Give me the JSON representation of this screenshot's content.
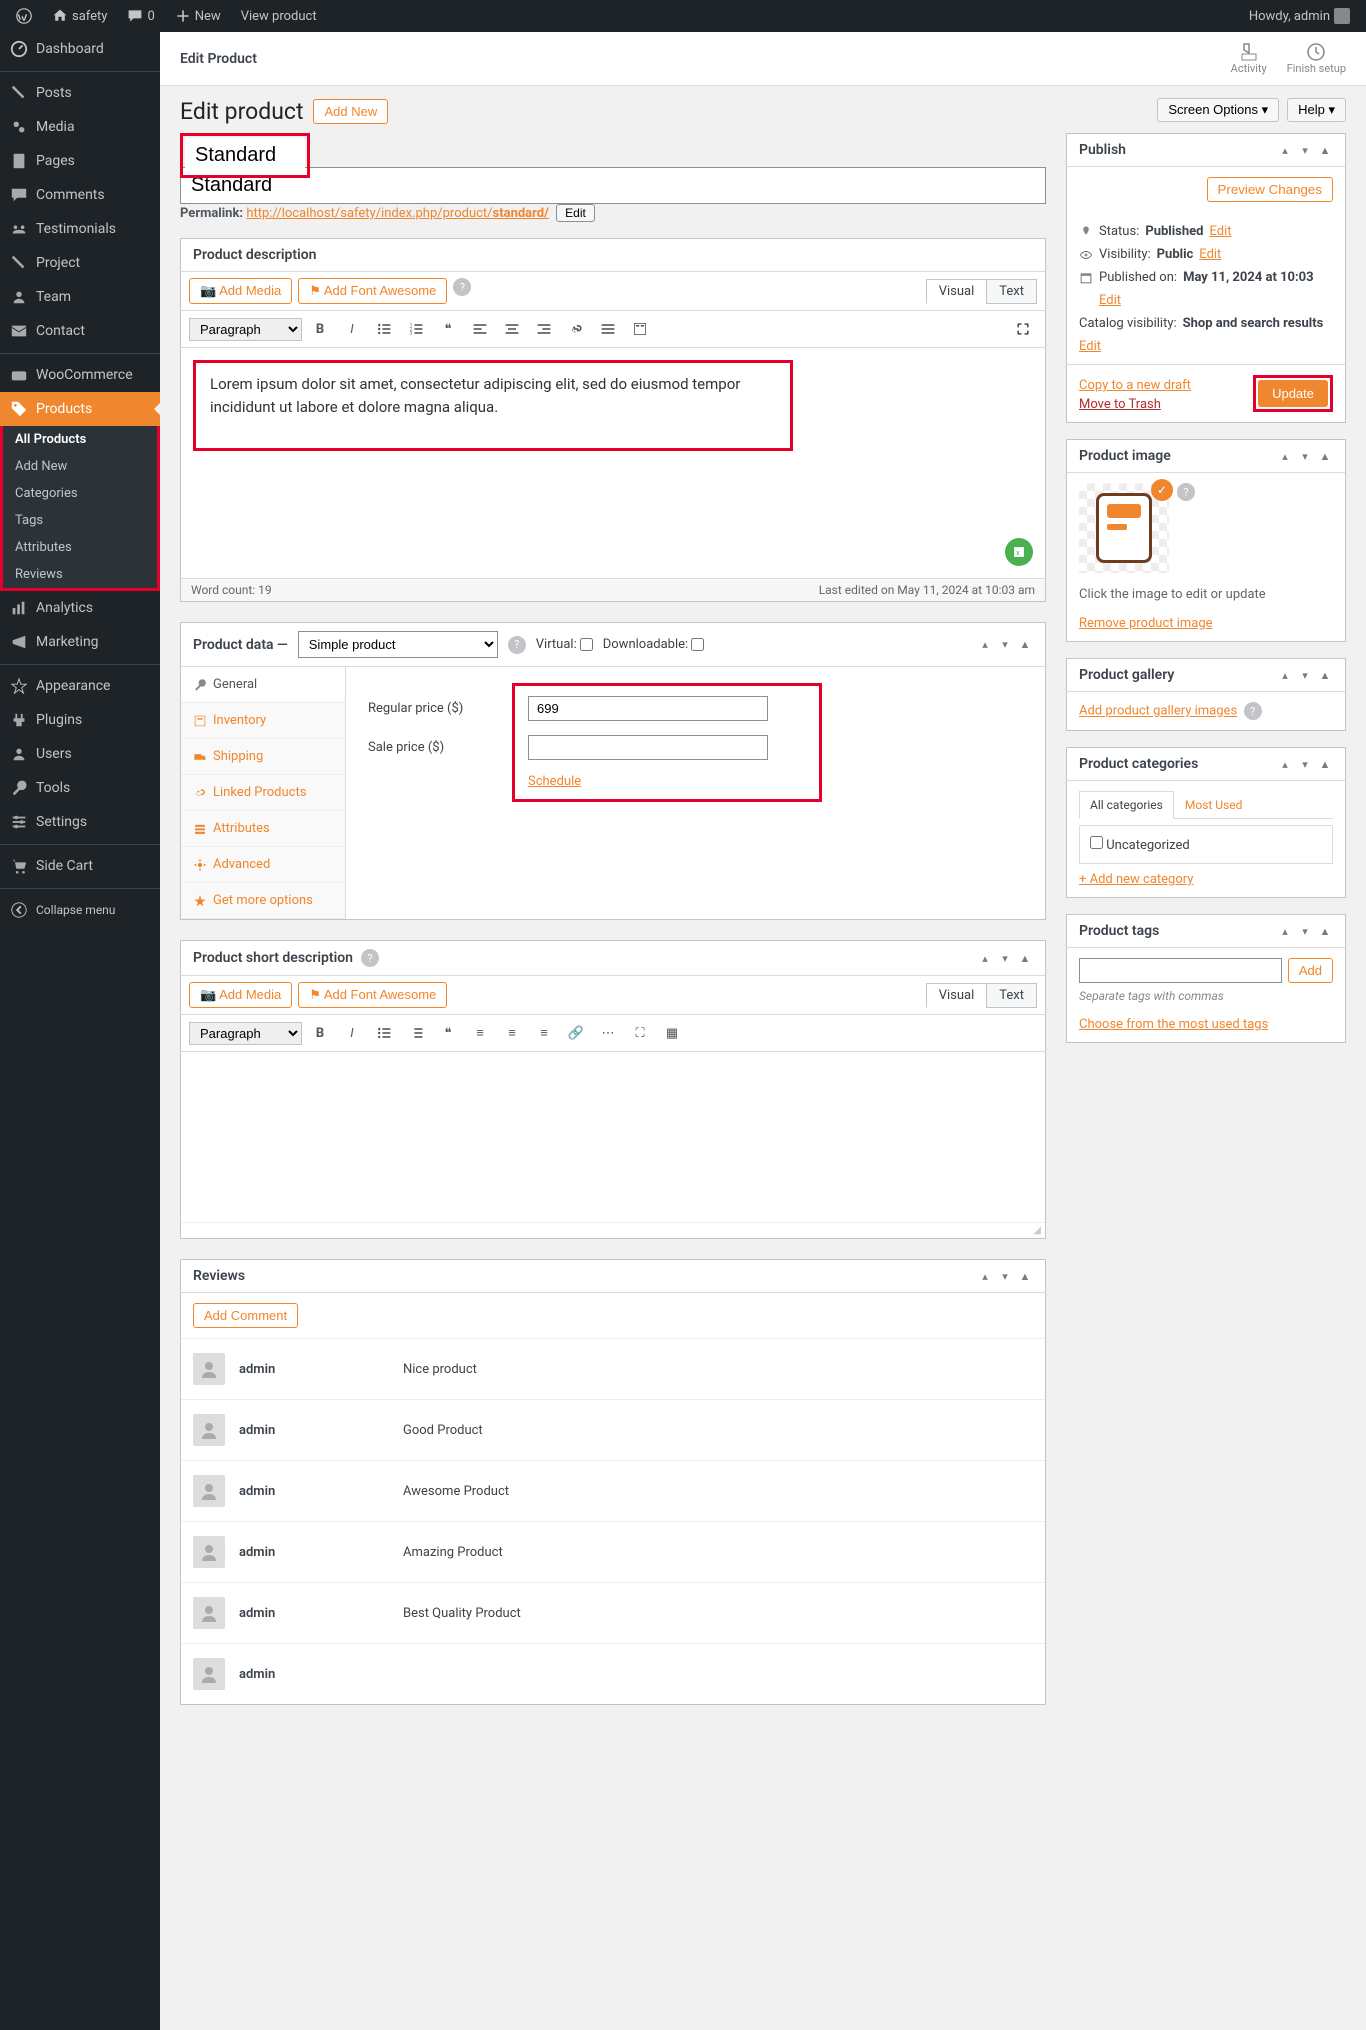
{
  "topbar": {
    "site": "safety",
    "comments": "0",
    "new": "New",
    "view": "View product",
    "howdy": "Howdy, admin"
  },
  "sidebar": {
    "items": [
      {
        "label": "Dashboard"
      },
      {
        "label": "Posts"
      },
      {
        "label": "Media"
      },
      {
        "label": "Pages"
      },
      {
        "label": "Comments"
      },
      {
        "label": "Testimonials"
      },
      {
        "label": "Project"
      },
      {
        "label": "Team"
      },
      {
        "label": "Contact"
      },
      {
        "label": "WooCommerce"
      },
      {
        "label": "Products"
      },
      {
        "label": "Analytics"
      },
      {
        "label": "Marketing"
      },
      {
        "label": "Appearance"
      },
      {
        "label": "Plugins"
      },
      {
        "label": "Users"
      },
      {
        "label": "Tools"
      },
      {
        "label": "Settings"
      },
      {
        "label": "Side Cart"
      },
      {
        "label": "Collapse menu"
      }
    ],
    "sub": [
      "All Products",
      "Add New",
      "Categories",
      "Tags",
      "Attributes",
      "Reviews"
    ]
  },
  "header": {
    "edit_product": "Edit Product",
    "activity": "Activity",
    "finish": "Finish setup",
    "title": "Edit product",
    "add_new": "Add New",
    "screen_options": "Screen Options ▾",
    "help": "Help ▾"
  },
  "title_field": "Standard",
  "permalink": {
    "label": "Permalink:",
    "base": "http://localhost/safety/index.php/product/",
    "slug": "standard/",
    "edit": "Edit"
  },
  "desc": {
    "heading": "Product description",
    "add_media": "Add Media",
    "add_fa": "Add Font Awesome",
    "visual": "Visual",
    "text": "Text",
    "paragraph": "Paragraph",
    "content": "Lorem ipsum dolor sit amet, consectetur adipiscing elit, sed do eiusmod tempor incididunt ut labore et dolore magna aliqua.",
    "word_count": "Word count: 19",
    "last_edited": "Last edited on May 11, 2024 at 10:03 am"
  },
  "pd": {
    "heading": "Product data —",
    "type": "Simple product",
    "virtual": "Virtual:",
    "downloadable": "Downloadable:",
    "tabs": [
      "General",
      "Inventory",
      "Shipping",
      "Linked Products",
      "Attributes",
      "Advanced",
      "Get more options"
    ],
    "regular_label": "Regular price ($)",
    "regular_value": "699",
    "sale_label": "Sale price ($)",
    "sale_value": "",
    "schedule": "Schedule"
  },
  "short": {
    "heading": "Product short description"
  },
  "reviews": {
    "heading": "Reviews",
    "add": "Add Comment",
    "items": [
      {
        "author": "admin",
        "text": "Nice product"
      },
      {
        "author": "admin",
        "text": "Good Product"
      },
      {
        "author": "admin",
        "text": "Awesome Product"
      },
      {
        "author": "admin",
        "text": "Amazing Product"
      },
      {
        "author": "admin",
        "text": "Best Quality Product"
      },
      {
        "author": "admin",
        "text": ""
      }
    ]
  },
  "publish": {
    "heading": "Publish",
    "preview": "Preview Changes",
    "status_label": "Status:",
    "status": "Published",
    "edit": "Edit",
    "visibility_label": "Visibility:",
    "visibility": "Public",
    "published_label": "Published on:",
    "published": "May 11, 2024 at 10:03",
    "catalog_label": "Catalog visibility:",
    "catalog": "Shop and search results",
    "copy": "Copy to a new draft",
    "trash": "Move to Trash",
    "update": "Update"
  },
  "pimg": {
    "heading": "Product image",
    "hint": "Click the image to edit or update",
    "remove": "Remove product image"
  },
  "gallery": {
    "heading": "Product gallery",
    "add": "Add product gallery images"
  },
  "cats": {
    "heading": "Product categories",
    "all": "All categories",
    "most": "Most Used",
    "uncat": "Uncategorized",
    "add": "+ Add new category"
  },
  "tags": {
    "heading": "Product tags",
    "add": "Add",
    "hint": "Separate tags with commas",
    "choose": "Choose from the most used tags"
  }
}
